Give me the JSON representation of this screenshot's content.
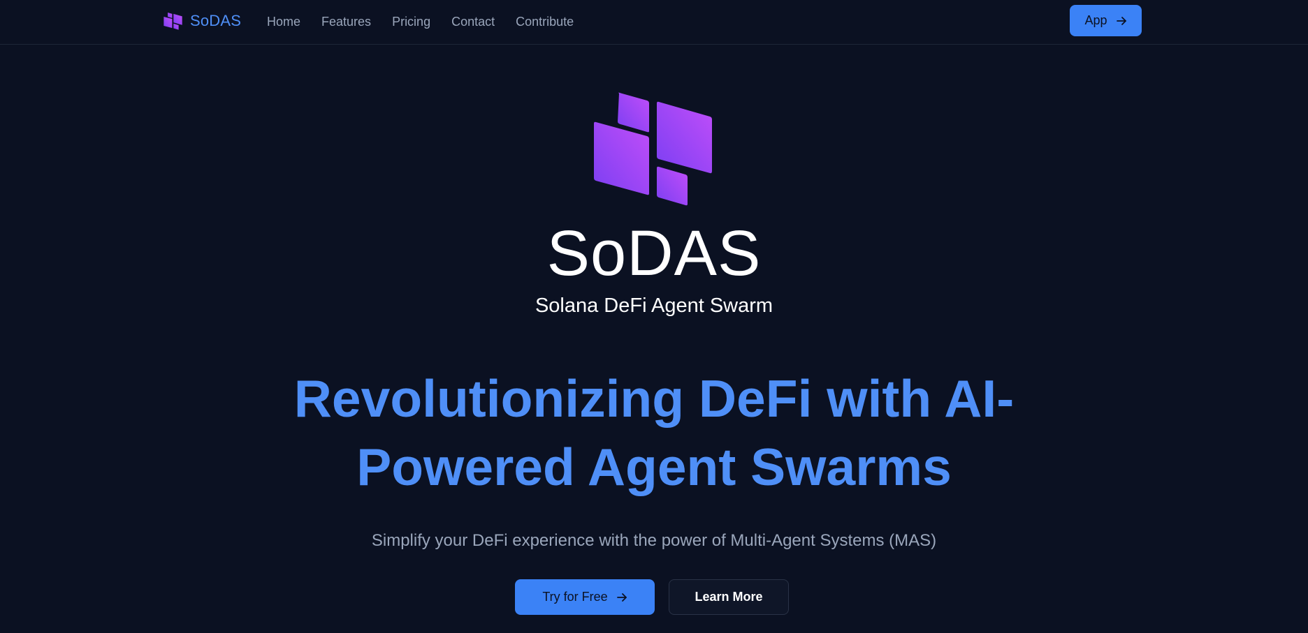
{
  "brand": {
    "name": "SoDAS",
    "logo_icon": "sodas-logo-icon"
  },
  "nav": {
    "items": [
      {
        "label": "Home"
      },
      {
        "label": "Features"
      },
      {
        "label": "Pricing"
      },
      {
        "label": "Contact"
      },
      {
        "label": "Contribute"
      }
    ],
    "app_button": {
      "label": "App",
      "icon": "arrow-right-icon"
    }
  },
  "hero": {
    "title": "SoDAS",
    "subtitle": "Solana DeFi Agent Swarm",
    "headline_line1": "Revolutionizing DeFi with AI-",
    "headline_line2": "Powered Agent Swarms",
    "tagline": "Simplify your DeFi experience with the power of Multi-Agent Systems (MAS)",
    "primary_button": {
      "label": "Try for Free",
      "icon": "arrow-right-icon"
    },
    "secondary_button": {
      "label": "Learn More"
    }
  },
  "colors": {
    "background": "#0b1122",
    "accent": "#3b82f6",
    "headline": "#4f8ff7",
    "muted_text": "#9aa6bb",
    "logo_gradient_start": "#7b3ff2",
    "logo_gradient_end": "#c14ef9"
  }
}
